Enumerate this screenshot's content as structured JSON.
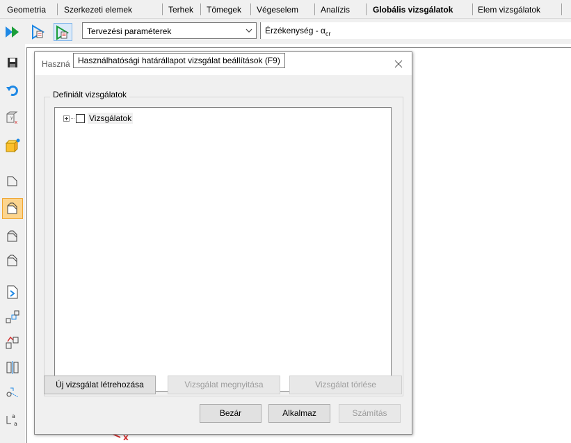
{
  "tabs": [
    {
      "label": "Geometria"
    },
    {
      "label": "Szerkezeti elemek"
    },
    {
      "label": "Terhek"
    },
    {
      "label": "Tömegek"
    },
    {
      "label": "Végeselem"
    },
    {
      "label": "Analízis"
    },
    {
      "label": "Globális vizsgálatok",
      "active": true
    },
    {
      "label": "Elem vizsgálatok"
    }
  ],
  "toolbar": {
    "param_select": "Tervezési paraméterek",
    "sensitivity_label": "Érzékenység - α",
    "sensitivity_sub": "cr"
  },
  "tooltip": {
    "text": "Használhatósági határállapot vizsgálat beállítások (F9)"
  },
  "dialog": {
    "title": "Haszná",
    "group_label": "Definiált vizsgálatok",
    "tree_root": "Vizsgálatok",
    "buttons": {
      "create": "Új vizsgálat létrehozása",
      "open": "Vizsgálat megnyitása",
      "delete": "Vizsgálat törlése",
      "close": "Bezár",
      "apply": "Alkalmaz",
      "calculate": "Számítás"
    }
  },
  "left_toolbar_icons": [
    "save-icon",
    "undo-icon",
    "coordinate-icon",
    "solid-box-icon",
    "plate-outline-icon",
    "plate-filled-icon",
    "shell-icon",
    "shell-outline-icon",
    "document-arrow-icon",
    "nodes-icon",
    "nodes-red-icon",
    "mirror-icon",
    "scale-icon",
    "rename-icon"
  ],
  "canvas": {
    "axis_label": "x"
  },
  "colors": {
    "accent": "#fcd58f",
    "play_green": "#1a9e3a",
    "play_blue": "#1e88e5"
  }
}
